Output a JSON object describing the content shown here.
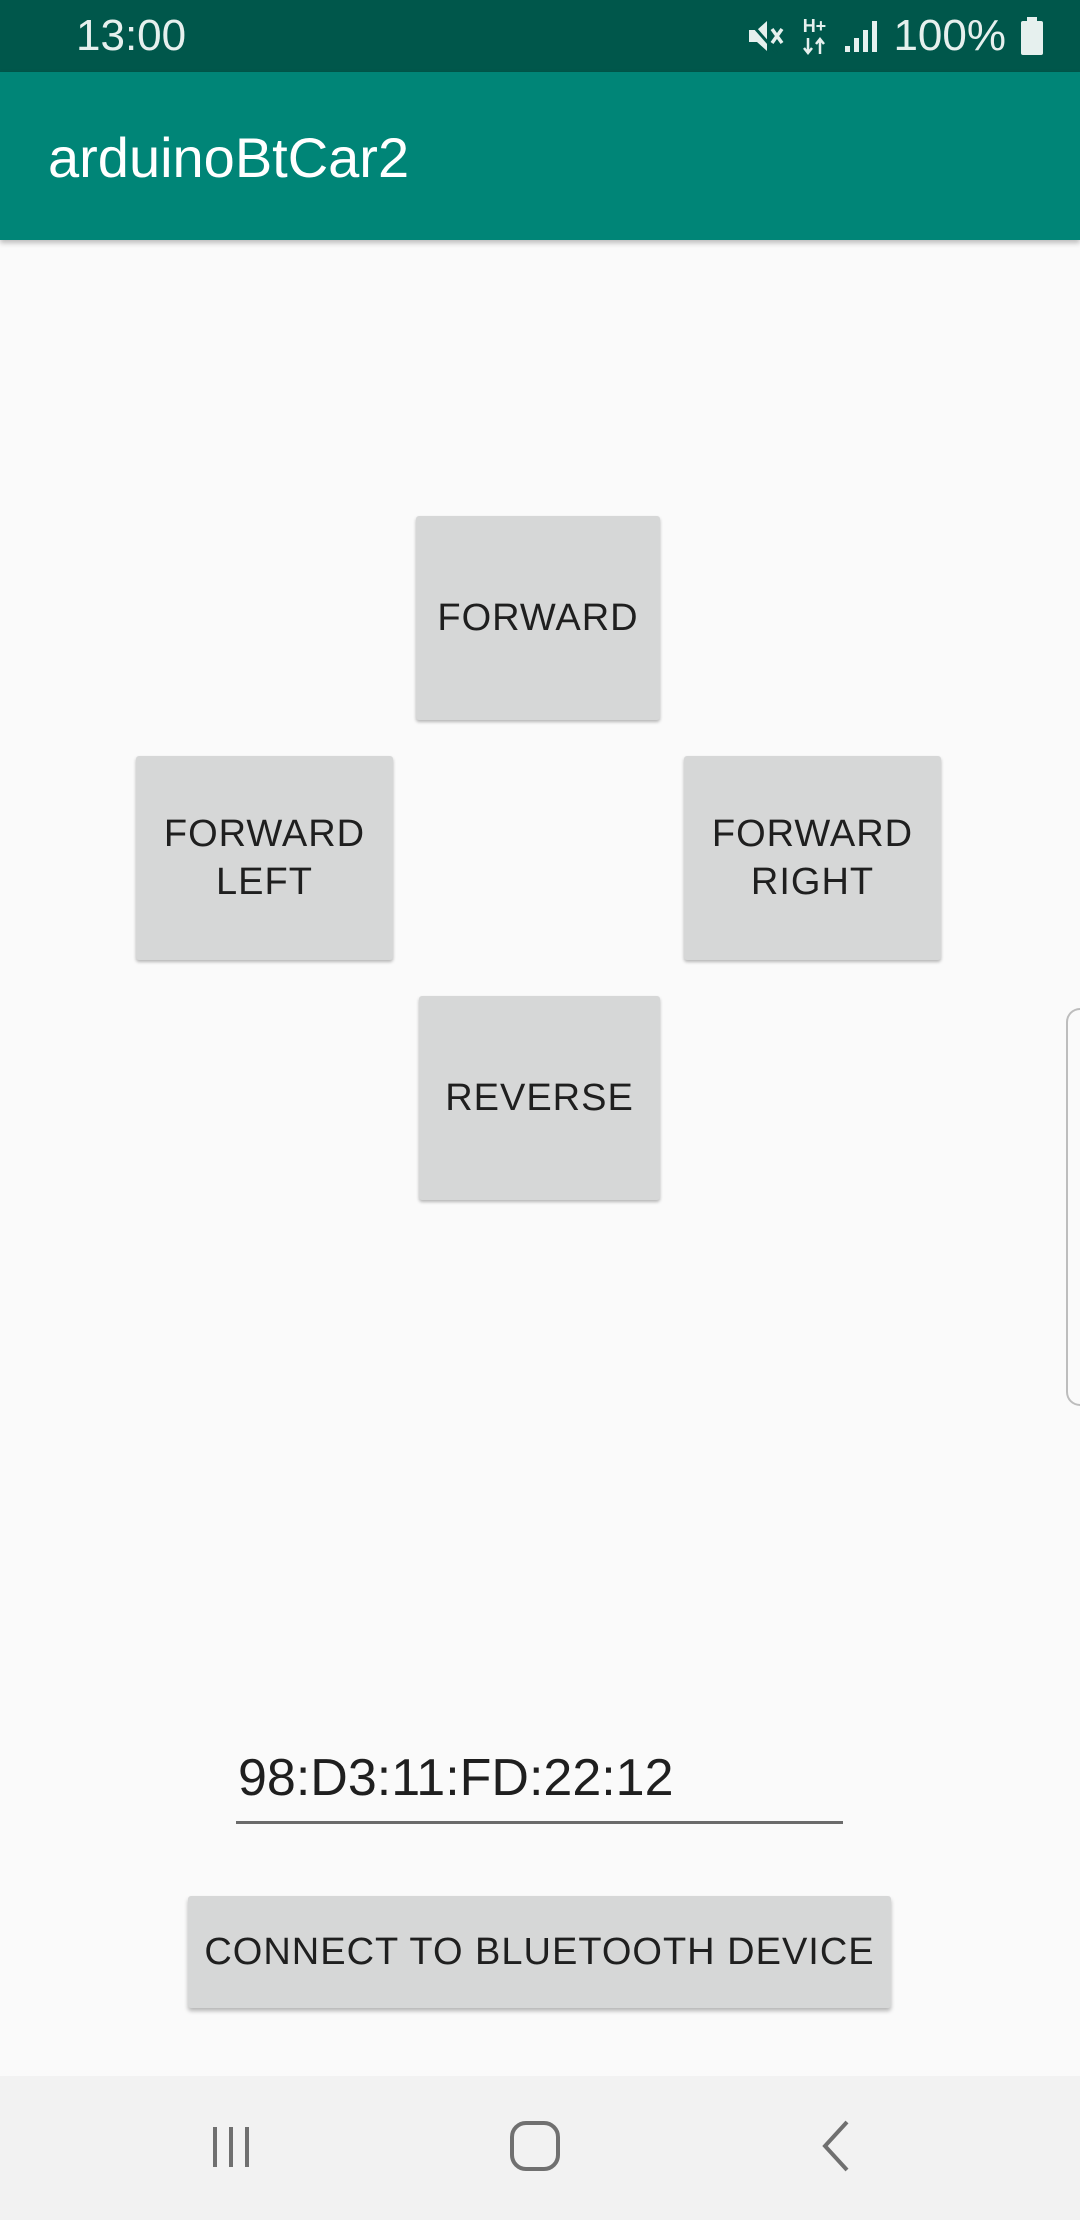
{
  "status_bar": {
    "time": "13:00",
    "network_type": "H+",
    "battery_percent": "100%",
    "icons": [
      "mute-icon",
      "network-icon",
      "signal-icon",
      "battery-icon"
    ]
  },
  "app_bar": {
    "title": "arduinoBtCar2",
    "color": "#008577"
  },
  "controls": {
    "forward": {
      "line1": "FORWARD",
      "line2": ""
    },
    "forward_left": {
      "line1": "FORWARD",
      "line2": "LEFT"
    },
    "forward_right": {
      "line1": "FORWARD",
      "line2": "RIGHT"
    },
    "reverse": {
      "line1": "REVERSE",
      "line2": ""
    }
  },
  "bluetooth": {
    "address_value": "98:D3:11:FD:22:12",
    "connect_label": "CONNECT TO BLUETOOTH DEVICE"
  },
  "nav_bar": {
    "icons": [
      "recents-icon",
      "home-icon",
      "back-icon"
    ]
  },
  "colors": {
    "status_bar": "#00574b",
    "button_bg": "#d6d7d7",
    "background": "#fafafa"
  }
}
